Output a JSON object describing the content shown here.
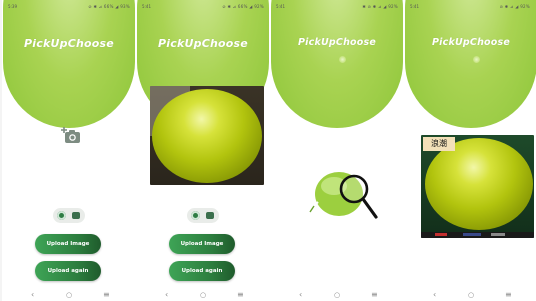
{
  "app": {
    "title": "PickUpChoose"
  },
  "theme": {
    "primary": "#8ec63a",
    "button": "#2c7d3e"
  },
  "screens": [
    {
      "time": "5:39",
      "status_icons": "⊘ ✱ ⊿ 66% ◢ 93%",
      "buttons": {
        "upload_image": "Upload Image",
        "upload_again": "Upload again"
      }
    },
    {
      "time": "5:41",
      "status_icons": "⊘ ✱ ⊿ 66% ◢ 92%",
      "buttons": {
        "upload_image": "Upload Image",
        "upload_again": "Upload again"
      }
    },
    {
      "time": "5:41",
      "status_icons": "✱ ⊘ ✱ ⊿ ◢ 92%"
    },
    {
      "time": "5:41",
      "status_icons": "⊘ ✱ ⊿ ◢ 92%",
      "result": {
        "label": "浪潮"
      }
    }
  ],
  "navbar": {
    "back": "‹",
    "home": "○",
    "recents": "≡"
  },
  "icons": {
    "camera": "camera-add-icon",
    "capture": "camera-icon",
    "gallery": "gallery-icon",
    "search": "magnifier-icon"
  }
}
